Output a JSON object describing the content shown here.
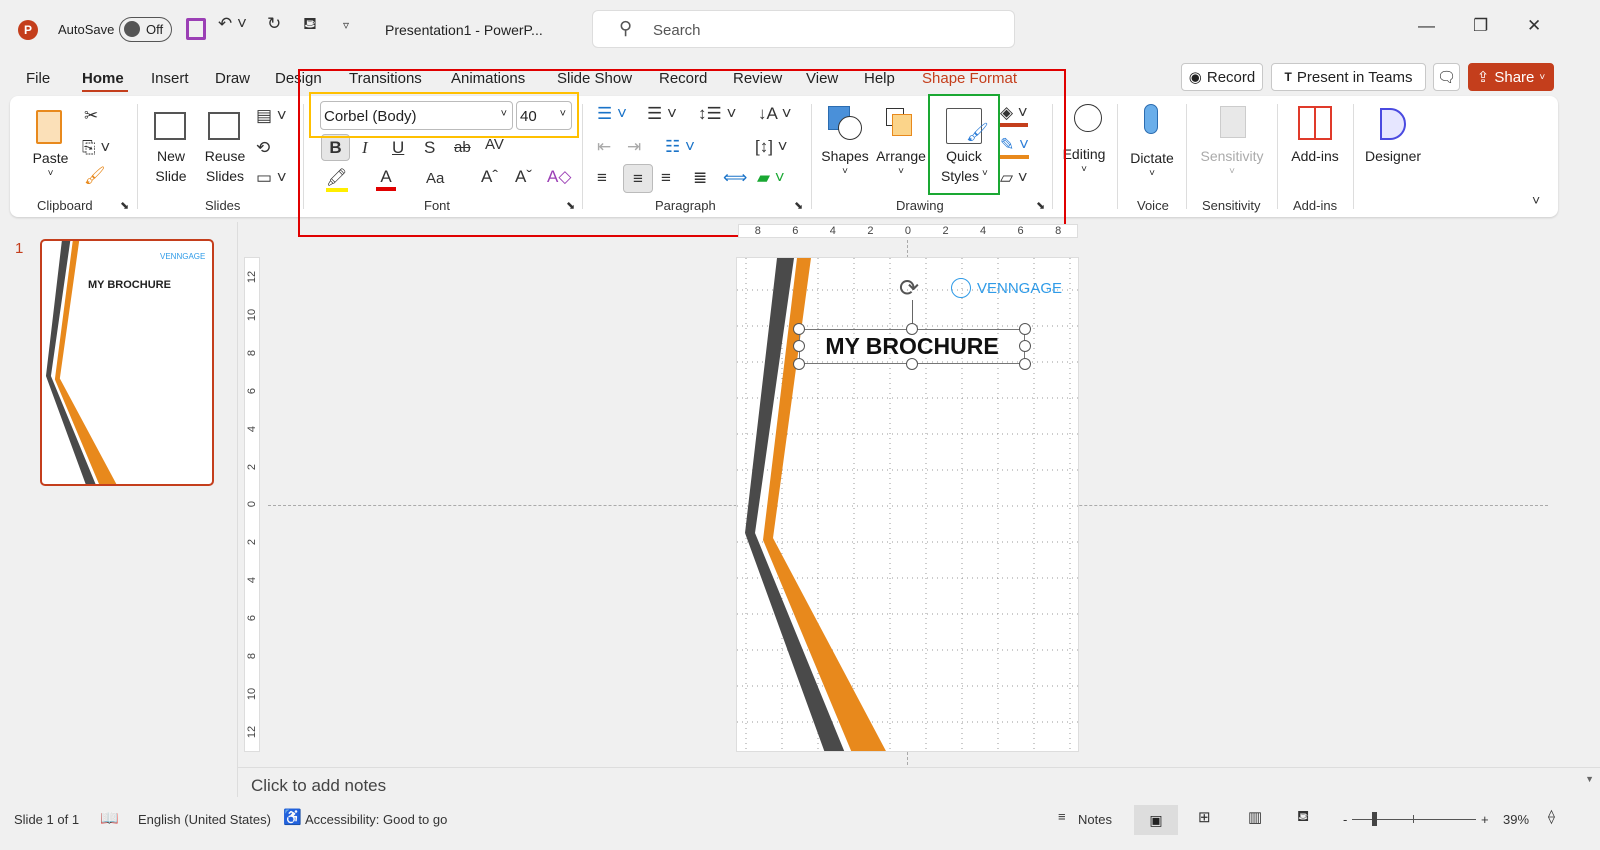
{
  "titlebar": {
    "autosave_label": "AutoSave",
    "autosave_state": "Off",
    "doc_title": "Presentation1  -  PowerP...",
    "search_placeholder": "Search"
  },
  "tabs": [
    {
      "label": "File"
    },
    {
      "label": "Home",
      "active": true
    },
    {
      "label": "Insert"
    },
    {
      "label": "Draw"
    },
    {
      "label": "Design"
    },
    {
      "label": "Transitions"
    },
    {
      "label": "Animations"
    },
    {
      "label": "Slide Show"
    },
    {
      "label": "Record"
    },
    {
      "label": "Review"
    },
    {
      "label": "View"
    },
    {
      "label": "Help"
    },
    {
      "label": "Shape Format",
      "color": "#c43e1c"
    }
  ],
  "header_buttons": {
    "record": "Record",
    "present": "Present in Teams",
    "share": "Share"
  },
  "ribbon": {
    "clipboard": {
      "paste": "Paste",
      "group": "Clipboard"
    },
    "slides": {
      "new_slide": "New",
      "new_slide2": "Slide",
      "reuse": "Reuse",
      "reuse2": "Slides",
      "group": "Slides"
    },
    "font": {
      "font_name": "Corbel (Body)",
      "font_size": "40",
      "group": "Font",
      "bold": "B",
      "italic": "I",
      "underline": "U",
      "shadow": "S",
      "strike": "ab",
      "spacing": "AV",
      "case": "Aa"
    },
    "paragraph": {
      "group": "Paragraph"
    },
    "drawing": {
      "shapes": "Shapes",
      "arrange": "Arrange",
      "quick": "Quick",
      "styles": "Styles",
      "group": "Drawing"
    },
    "editing": {
      "label": "Editing"
    },
    "voice": {
      "dictate": "Dictate",
      "group": "Voice"
    },
    "sensitivity": {
      "label": "Sensitivity",
      "group": "Sensitivity"
    },
    "addins": {
      "label": "Add-ins",
      "group": "Add-ins"
    },
    "designer": {
      "label": "Designer"
    }
  },
  "thumbnail": {
    "number": "1",
    "title": "MY BROCHURE",
    "logo": "VENNGAGE"
  },
  "slide": {
    "title": "MY BROCHURE",
    "logo": "VENNGAGE"
  },
  "ruler": {
    "h_ticks": [
      "8",
      "6",
      "4",
      "2",
      "0",
      "2",
      "4",
      "6",
      "8"
    ],
    "v_ticks": [
      "12",
      "10",
      "8",
      "6",
      "4",
      "2",
      "0",
      "2",
      "4",
      "6",
      "8",
      "10",
      "12"
    ]
  },
  "notes_placeholder": "Click to add notes",
  "status": {
    "slide": "Slide 1 of 1",
    "language": "English (United States)",
    "accessibility": "Accessibility: Good to go",
    "notes": "Notes",
    "zoom": "39%",
    "zoom_minus": "-",
    "zoom_plus": "+"
  },
  "colors": {
    "accent": "#c43e1c",
    "orange": "#e8891c",
    "dark": "#4a4a4a",
    "venngage": "#2f9be8",
    "highlight_red": "#e00000",
    "highlight_yellow": "#ffc000",
    "highlight_green": "#1aa833"
  }
}
